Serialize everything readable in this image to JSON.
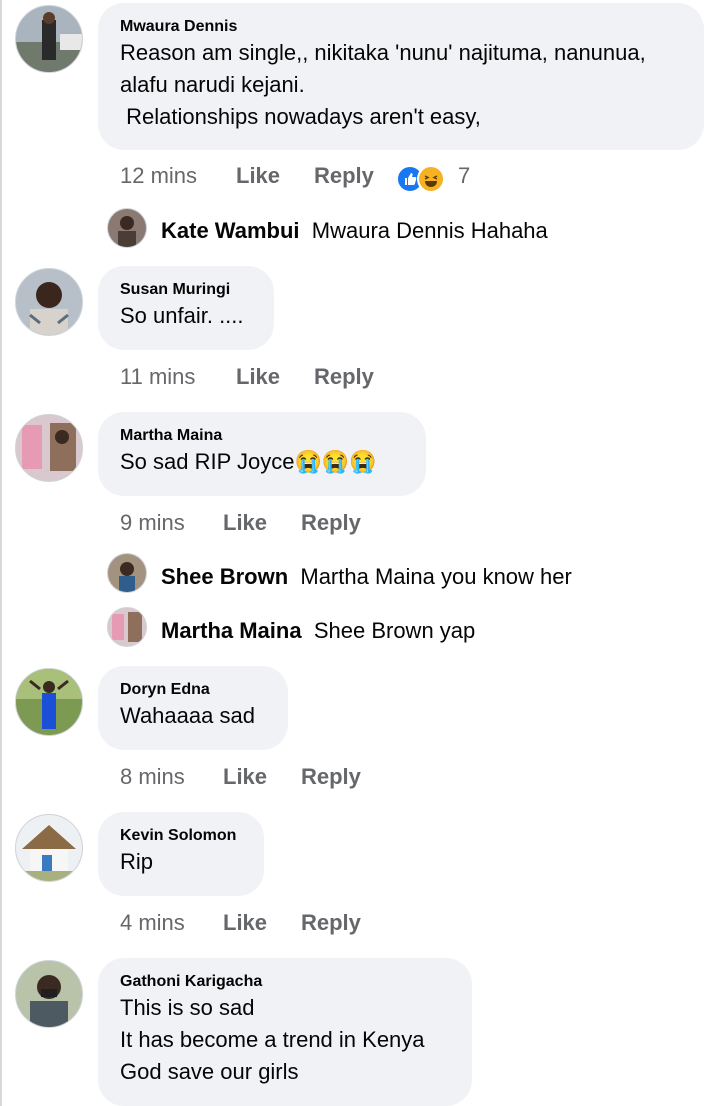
{
  "comments": [
    {
      "author": "Mwaura Dennis",
      "lines": [
        "Reason am single,, nikitaka 'nunu' najituma, nanunua,",
        "alafu narudi kejani.",
        " Relationships nowadays aren't easy,"
      ],
      "time": "12 mins",
      "like": "Like",
      "reply": "Reply",
      "reaction_count": "7",
      "reactions": [
        "like-icon",
        "haha-icon"
      ]
    },
    {
      "author": "Susan Muringi",
      "lines": [
        "So unfair. ...."
      ],
      "time": "11 mins",
      "like": "Like",
      "reply": "Reply"
    },
    {
      "author": "Martha Maina",
      "lines": [
        "So sad RIP Joyce"
      ],
      "emoji": "😭😭😭",
      "time": "9 mins",
      "like": "Like",
      "reply": "Reply"
    },
    {
      "author": "Doryn Edna",
      "lines": [
        "Wahaaaa sad"
      ],
      "time": "8 mins",
      "like": "Like",
      "reply": "Reply"
    },
    {
      "author": "Kevin Solomon",
      "lines": [
        "Rip"
      ],
      "time": "4 mins",
      "like": "Like",
      "reply": "Reply"
    },
    {
      "author": "Gathoni Karigacha",
      "lines": [
        "This is so sad",
        "It has become a trend in Kenya",
        "God save our girls"
      ]
    }
  ],
  "replies": [
    {
      "author": "Kate Wambui",
      "text": "Mwaura Dennis Hahaha"
    },
    {
      "author": "Shee Brown",
      "text": "Martha Maina you know her"
    },
    {
      "author": "Martha Maina",
      "text": "Shee Brown yap"
    }
  ],
  "colors": {
    "bubble": "#f0f2f5",
    "meta": "#65676b",
    "like_blue": "#1877f2",
    "haha_yellow": "#f7b125"
  }
}
